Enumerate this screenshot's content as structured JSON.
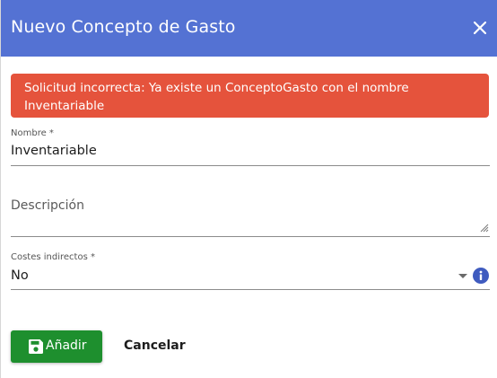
{
  "dialog": {
    "title": "Nuevo Concepto de Gasto",
    "close_icon": "close-icon"
  },
  "alert": {
    "message": "Solicitud incorrecta: Ya existe un ConceptoGasto con el nombre Inventariable"
  },
  "form": {
    "nombre": {
      "label": "Nombre *",
      "value": "Inventariable"
    },
    "descripcion": {
      "label": "Descripción",
      "value": ""
    },
    "costes": {
      "label": "Costes indirectos *",
      "value": "No",
      "info_icon": "info-icon",
      "arrow_icon": "dropdown-arrow-icon"
    }
  },
  "actions": {
    "add_label": "Añadir",
    "add_icon": "save-icon",
    "cancel_label": "Cancelar"
  },
  "colors": {
    "header": "#5472d3",
    "alert": "#e5533c",
    "add_button": "#1e8f2e",
    "info": "#3f5bbf"
  }
}
